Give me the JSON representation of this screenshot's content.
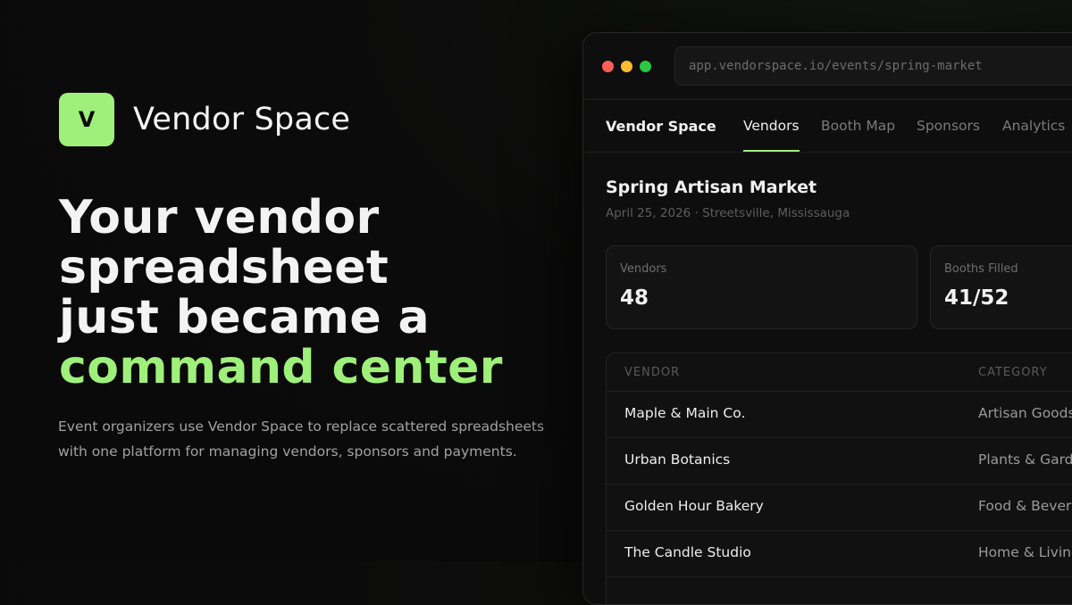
{
  "brand": {
    "logo_letter": "V",
    "name": "Vendor Space",
    "accent_color": "#9ef07a"
  },
  "hero": {
    "headline_lines": [
      "Your vendor",
      "spreadsheet",
      "just became a"
    ],
    "headline_accent": "command center",
    "subcopy": "Event organizers use Vendor Space to replace scattered spreadsheets with one platform for managing vendors, sponsors and payments."
  },
  "browser": {
    "url": "app.vendorspace.io/events/spring-market",
    "window_controls": [
      "close",
      "minimize",
      "maximize"
    ]
  },
  "app": {
    "brand": "Vendor Space",
    "tabs": [
      {
        "label": "Vendors",
        "active": true
      },
      {
        "label": "Booth Map",
        "active": false
      },
      {
        "label": "Sponsors",
        "active": false
      },
      {
        "label": "Analytics",
        "active": false
      }
    ],
    "event": {
      "title": "Spring Artisan Market",
      "meta": "April 25, 2026 · Streetsville, Mississauga"
    },
    "stats": [
      {
        "label": "Vendors",
        "value": "48"
      },
      {
        "label": "Booths Filled",
        "value": "41/52"
      }
    ],
    "table": {
      "headers": [
        "VENDOR",
        "CATEGORY"
      ],
      "rows": [
        {
          "vendor": "Maple & Main Co.",
          "category": "Artisan Goods"
        },
        {
          "vendor": "Urban Botanics",
          "category": "Plants & Garden"
        },
        {
          "vendor": "Golden Hour Bakery",
          "category": "Food & Beverage"
        },
        {
          "vendor": "The Candle Studio",
          "category": "Home & Living"
        }
      ]
    }
  }
}
